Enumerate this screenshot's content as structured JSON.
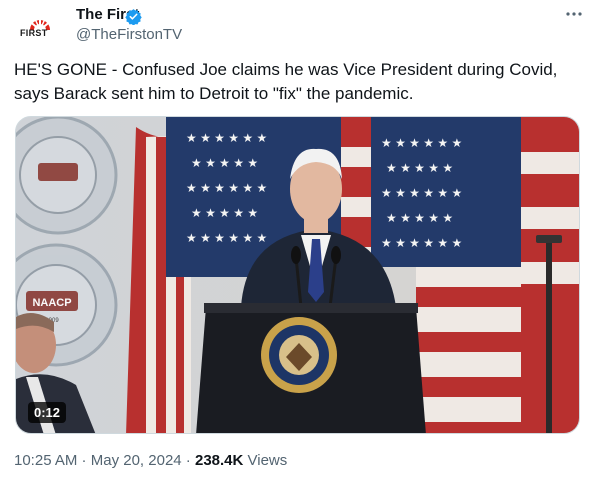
{
  "account": {
    "name": "The First",
    "handle": "@TheFirstonTV",
    "logo_text": "FIRST"
  },
  "tweet": {
    "text": "HE'S GONE - Confused Joe claims he was Vice President during Covid, says Barack sent him to Detroit to \"fix\" the pandemic."
  },
  "media": {
    "duration": "0:12",
    "banner_text": "NAACP",
    "banner_year": "1909"
  },
  "meta": {
    "time": "10:25 AM",
    "sep1": " · ",
    "date": "May 20, 2024",
    "sep2": " · ",
    "views_count": "238.4K",
    "views_label": " Views"
  },
  "colors": {
    "verified": "#1d9bf0",
    "logo_red": "#e0251b",
    "text_secondary": "#536471"
  }
}
